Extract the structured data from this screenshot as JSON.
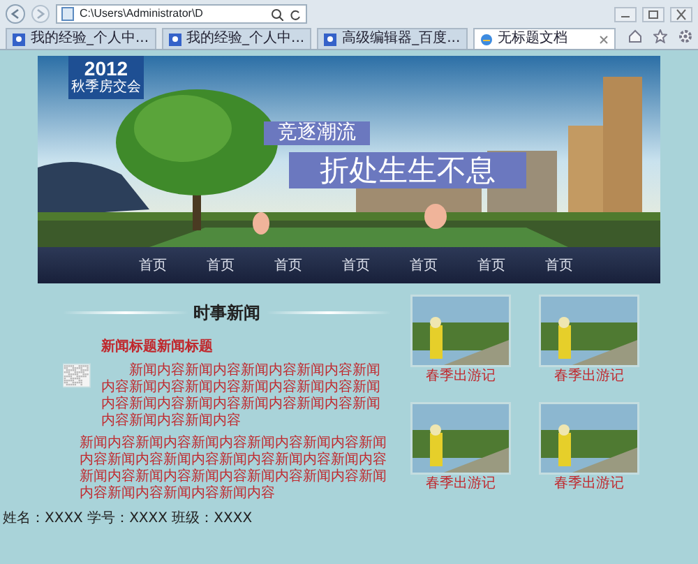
{
  "browser": {
    "address": "C:\\Users\\Administrator\\D",
    "tabs": [
      {
        "label": "我的经验_个人中...",
        "selected": false
      },
      {
        "label": "我的经验_个人中...",
        "selected": false
      },
      {
        "label": "高级编辑器_百度...",
        "selected": false
      },
      {
        "label": "无标题文档",
        "selected": true
      }
    ]
  },
  "banner": {
    "badge_year": "2012",
    "badge_text": "秋季房交会",
    "slogan_1": "竞逐潮流",
    "slogan_2": "折处生生不息"
  },
  "nav": [
    {
      "label": "首页"
    },
    {
      "label": "首页"
    },
    {
      "label": "首页"
    },
    {
      "label": "首页"
    },
    {
      "label": "首页"
    },
    {
      "label": "首页"
    },
    {
      "label": "首页"
    }
  ],
  "news": {
    "heading": "时事新闻",
    "title": "新闻标题新闻标题",
    "paragraphs": [
      "新闻内容新闻内容新闻内容新闻内容新闻内容新闻内容新闻内容新闻内容新闻内容新闻内容新闻内容新闻内容新闻内容新闻内容新闻内容新闻内容新闻内容",
      "新闻内容新闻内容新闻内容新闻内容新闻内容新闻内容新闻内容新闻内容新闻内容新闻内容新闻内容新闻内容新闻内容新闻内容新闻内容新闻内容新闻内容新闻内容新闻内容新闻内容"
    ]
  },
  "gallery": [
    {
      "caption": "春季出游记"
    },
    {
      "caption": "春季出游记"
    },
    {
      "caption": "春季出游记"
    },
    {
      "caption": "春季出游记"
    }
  ],
  "footer": "姓名：XXXX 学号：XXXX 班级：XXXX"
}
